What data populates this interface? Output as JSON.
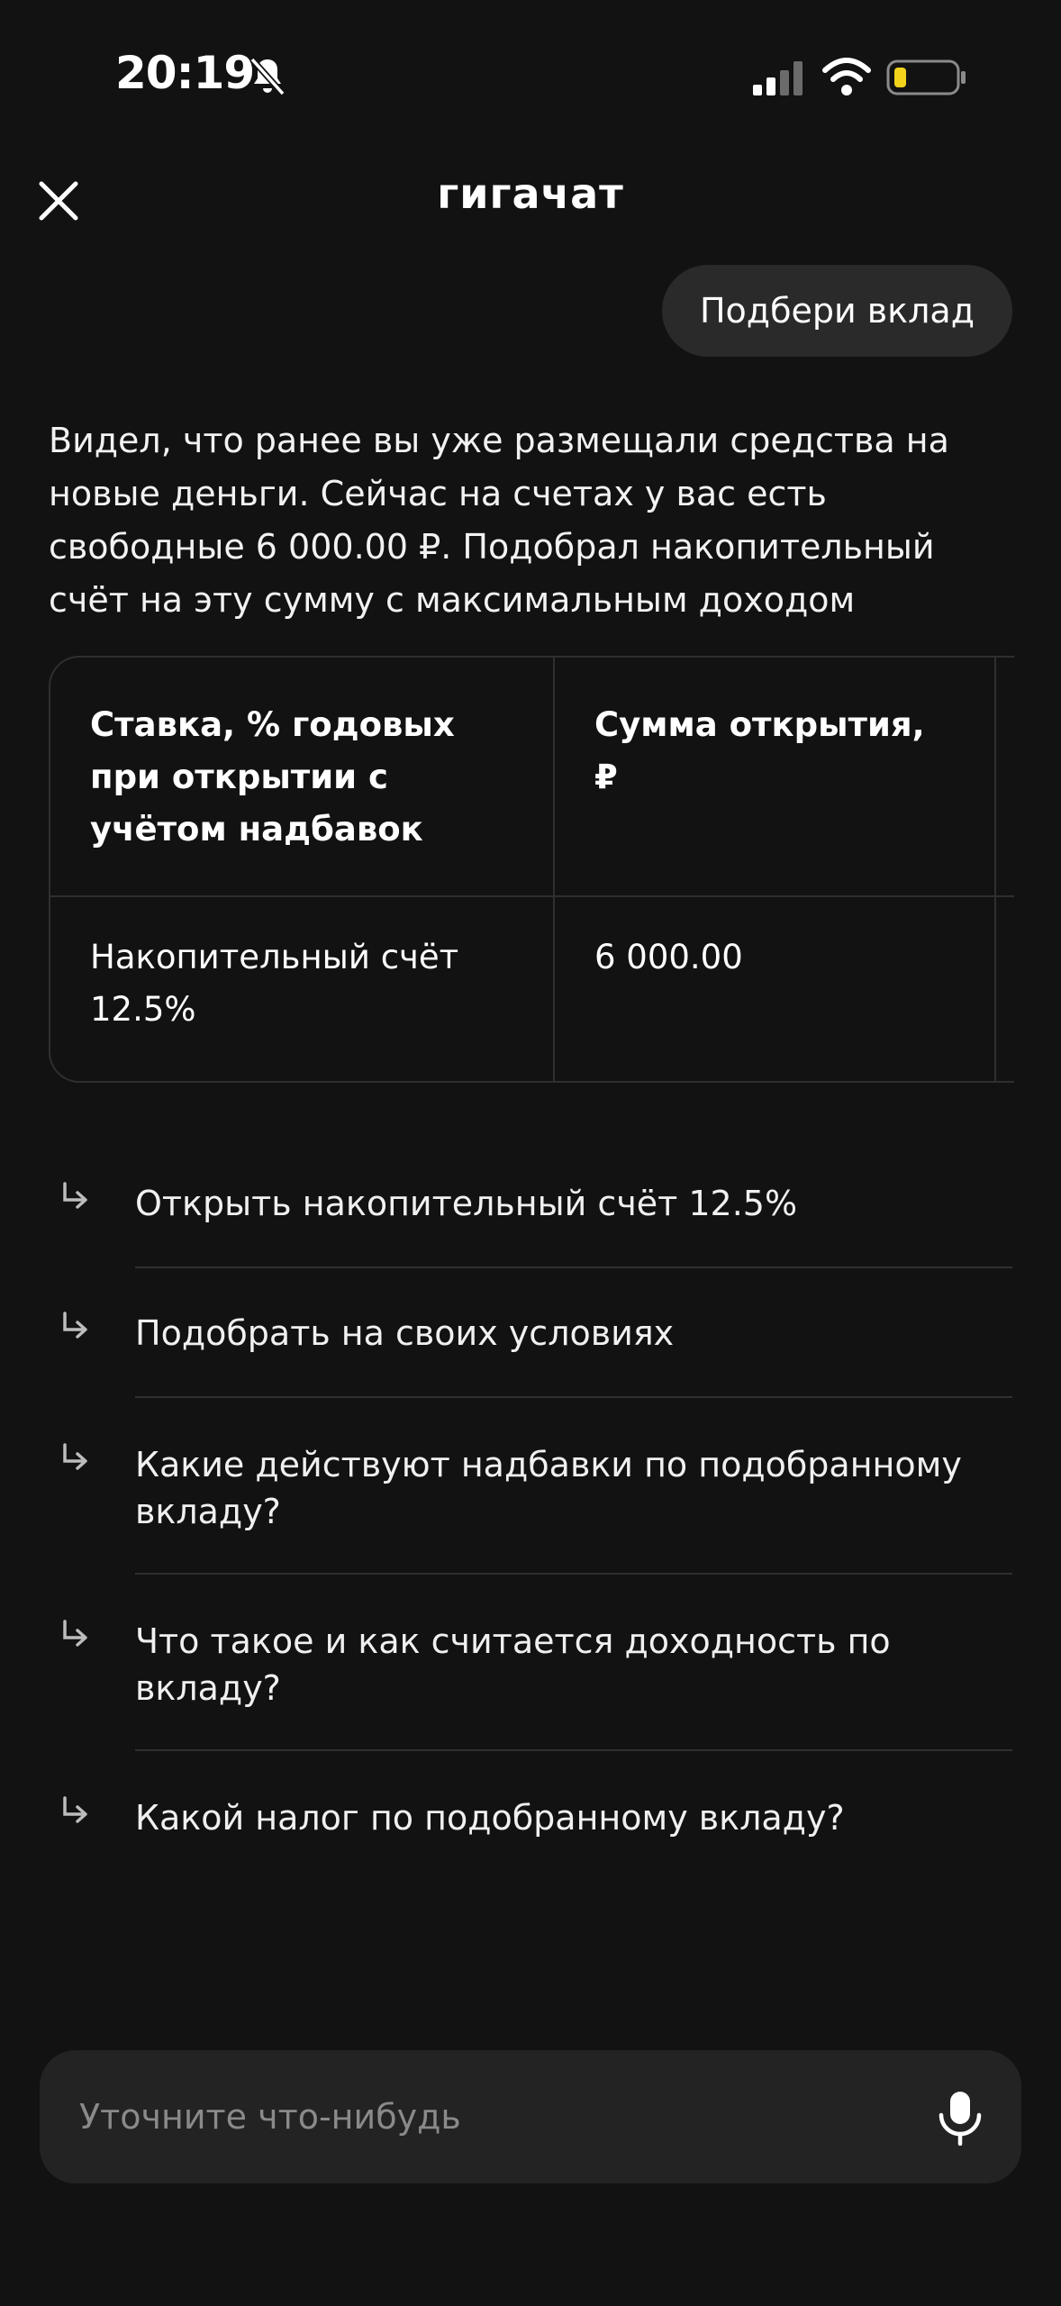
{
  "status_bar": {
    "time": "20:19"
  },
  "header": {
    "title": "гигачат"
  },
  "user_message": "Подбери вклад",
  "assistant_message": "Видел, что ранее вы уже размещали средства на новые деньги. Сейчас на счетах у вас есть свободные 6 000.00 ₽. Подобрал накопительный счёт на эту сумму с максимальным доходом",
  "table": {
    "headers": [
      "Ставка, % годовых при открытии с учётом надбавок",
      "Сумма открытия, ₽"
    ],
    "rows": [
      [
        "Накопительный счёт 12.5%",
        "6 000.00"
      ]
    ]
  },
  "suggestions": [
    "Открыть накопительный счёт 12.5%",
    "Подобрать на своих условиях",
    "Какие действуют надбавки по подобранному вкладу?",
    "Что такое и как считается доходность по вкладу?",
    "Какой налог по подобранному вкладу?"
  ],
  "input": {
    "placeholder": "Уточните что-нибудь"
  },
  "colors": {
    "background": "#121212",
    "bubble": "#2a2a2a",
    "input_bg": "#232323",
    "battery_accent": "#f2d21b"
  }
}
